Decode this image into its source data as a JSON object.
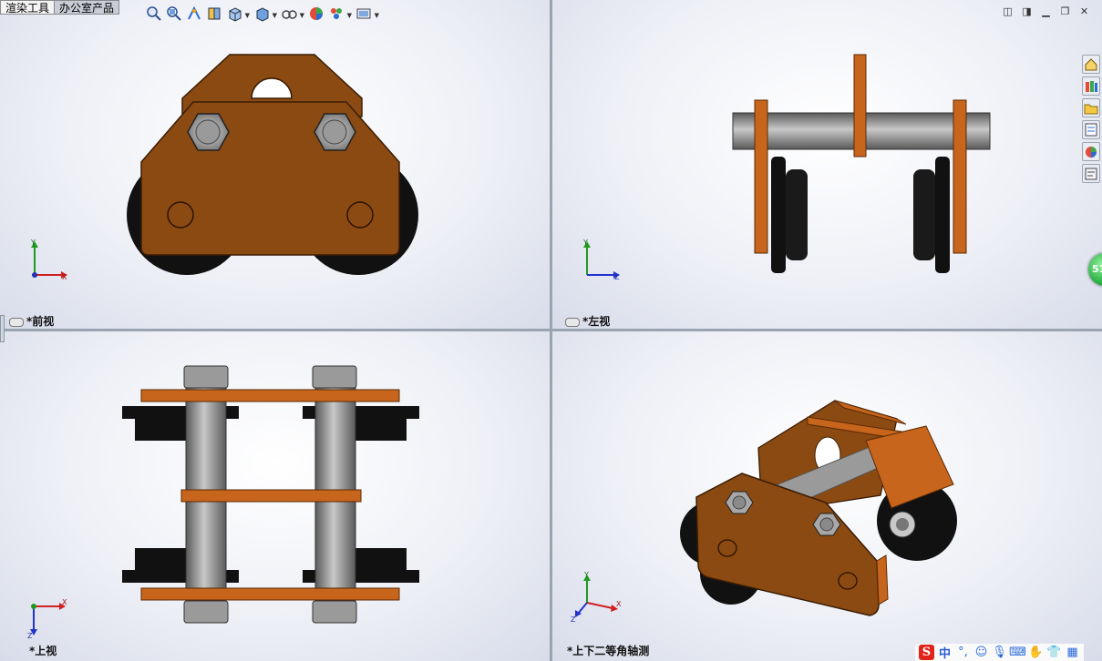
{
  "tabs": [
    {
      "label": "渲染工具",
      "active": true
    },
    {
      "label": "办公室产品",
      "active": false
    }
  ],
  "viewports": {
    "front": {
      "label": "*前视",
      "axis_h": "X",
      "axis_v": "Y"
    },
    "left": {
      "label": "*左视",
      "axis_h": "Z",
      "axis_v": "Y"
    },
    "top": {
      "label": "*上视",
      "axis_h": "X",
      "axis_v": "Z"
    },
    "iso": {
      "label": "*上下二等角轴测",
      "axis_h": "X",
      "axis_v": "Y",
      "axis_d": "Z"
    }
  },
  "heads_up_toolbar": [
    "zoom-to-fit-icon",
    "zoom-to-area-icon",
    "previous-view-icon",
    "section-view-icon",
    "view-orientation-icon",
    "display-style-icon",
    "hide-show-items-icon",
    "edit-appearance-icon",
    "apply-scene-icon",
    "view-settings-icon"
  ],
  "window_controls": [
    "tile-horizontal-icon",
    "tile-vertical-icon",
    "minimize-icon",
    "restore-icon",
    "close-icon"
  ],
  "task_pane": [
    "home-icon",
    "design-library-icon",
    "file-explorer-icon",
    "view-palette-icon",
    "appearances-icon",
    "custom-properties-icon"
  ],
  "float_badge": "51",
  "ime": {
    "brand": "S",
    "lang": "中",
    "punct": "°,",
    "icons": [
      "emoji-icon",
      "microphone-icon",
      "keyboard-icon",
      "skin-icon",
      "user-icon",
      "settings-icon"
    ]
  },
  "colors": {
    "plate": "#8a4a12",
    "plate_edge": "#6a3508",
    "wheel": "#141414",
    "steel": "#9a9a9a",
    "steel_dark": "#6c6c6c",
    "orange": "#c8651c"
  }
}
